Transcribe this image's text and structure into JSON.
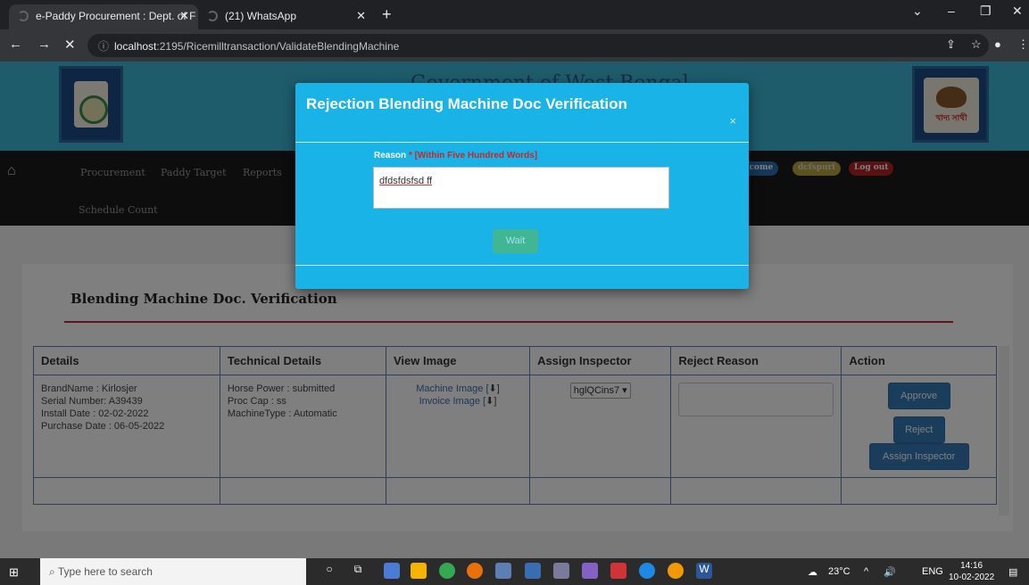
{
  "browser": {
    "tabs": [
      {
        "title": "e-Paddy Procurement : Dept. of F",
        "close": "✕"
      },
      {
        "title": "(21) WhatsApp",
        "close": "✕"
      }
    ],
    "new_tab": "+",
    "url_prefix": "localhost",
    "url_rest": ":2195/Ricemilltransaction/ValidateBlendingMachine"
  },
  "header": {
    "title": "Government of West Bengal",
    "right_logo_text": "খাদ্য সাথী"
  },
  "nav": {
    "items": [
      "Procurement",
      "Paddy Target",
      "Reports",
      "Schedule Count"
    ],
    "welcome": "Welcome",
    "user": "dcfspuri",
    "logout": "Log out"
  },
  "panel": {
    "title": "Blending Machine Doc. Verification"
  },
  "table": {
    "headers": [
      "Details",
      "Technical Details",
      "View Image",
      "Assign Inspector",
      "Reject Reason",
      "Action"
    ],
    "row": {
      "details": [
        "BrandName : Kirlosjer",
        "Serial Number: A39439",
        "Install Date : 02-02-2022",
        "Purchase Date : 06-05-2022"
      ],
      "technical": [
        "Horse Power : submitted",
        "Proc Cap : ss",
        "MachineType : Automatic"
      ],
      "machine_image": "Machine Image [",
      "invoice_image": "Invoice Image [",
      "inspector": "hglQCins7",
      "reject_reason": "",
      "approve": "Approve",
      "reject": "Reject",
      "assign": "Assign Inspector"
    }
  },
  "modal": {
    "title": "Rejection Blending Machine Doc Verification",
    "close": "×",
    "reason_label": "Reason",
    "reason_note": "* [Within Five Hundred Words]",
    "reason_value": "dfdsfdsfsd ff",
    "button": "Wait"
  },
  "taskbar": {
    "search_placeholder": "Type here to search",
    "temperature": "23°C",
    "lang": "ENG",
    "time": "14:16",
    "date": "10-02-2022"
  }
}
